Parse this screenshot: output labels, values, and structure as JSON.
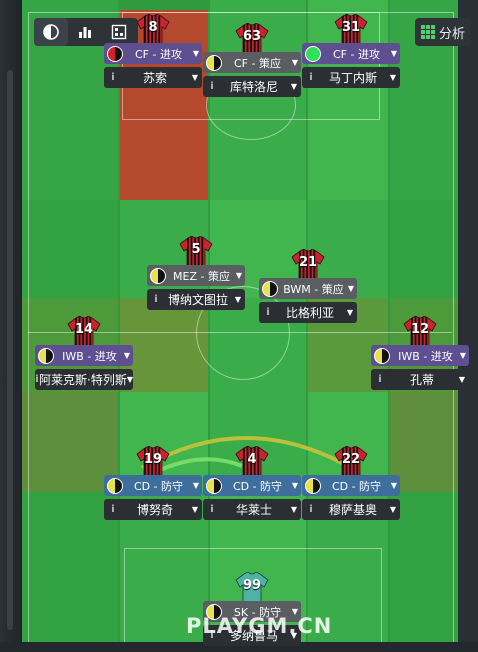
{
  "toolbar": {
    "buttons": [
      {
        "icon": "contrast-icon",
        "active": true
      },
      {
        "icon": "bar-chart-icon",
        "active": false
      },
      {
        "icon": "formation-icon",
        "active": false
      }
    ],
    "analysis_label": "分析"
  },
  "colors": {
    "attack_role": "#5e4f91",
    "support_role": "#5a5e63",
    "defend_role": "#3e6f9c",
    "name_box": "#2b2f33",
    "pitch_light": "#41b64f",
    "pitch_dark": "#2f9a3e",
    "red_zone": "#b5492e",
    "link_yellow": "#c9c23a",
    "link_green": "#7ee06a"
  },
  "players": [
    {
      "id": "st-left",
      "number": "8",
      "role": "CF - 进攻",
      "duty": "attack",
      "name": "苏索",
      "indicator": "half-red"
    },
    {
      "id": "st-center",
      "number": "63",
      "role": "CF - 策应",
      "duty": "support",
      "name": "库特洛尼",
      "indicator": "half-yellow"
    },
    {
      "id": "st-right",
      "number": "31",
      "role": "CF - 进攻",
      "duty": "attack",
      "name": "马丁内斯",
      "indicator": "full-green"
    },
    {
      "id": "mc-left",
      "number": "5",
      "role": "MEZ - 策应",
      "duty": "support",
      "name": "博纳文图拉",
      "indicator": "half-yellow"
    },
    {
      "id": "dm-center",
      "number": "21",
      "role": "BWM - 策应",
      "duty": "support",
      "name": "比格利亚",
      "indicator": "half-yellow"
    },
    {
      "id": "wb-left",
      "number": "14",
      "role": "IWB - 进攻",
      "duty": "attack",
      "name": "阿莱克斯·特列斯",
      "indicator": "half-yellow"
    },
    {
      "id": "wb-right",
      "number": "12",
      "role": "IWB - 进攻",
      "duty": "attack",
      "name": "孔蒂",
      "indicator": "half-yellow"
    },
    {
      "id": "cd-left",
      "number": "19",
      "role": "CD - 防守",
      "duty": "defend",
      "name": "博努奇",
      "indicator": "half-yellow"
    },
    {
      "id": "cd-center",
      "number": "4",
      "role": "CD - 防守",
      "duty": "defend",
      "name": "华莱士",
      "indicator": "half-yellow"
    },
    {
      "id": "cd-right",
      "number": "22",
      "role": "CD - 防守",
      "duty": "defend",
      "name": "穆萨基奥",
      "indicator": "half-yellow"
    },
    {
      "id": "gk",
      "number": "99",
      "role": "SK - 防守",
      "duty": "support",
      "name": "多纳鲁马",
      "indicator": "half-yellow"
    }
  ],
  "watermark": "PLAYGM.CN"
}
